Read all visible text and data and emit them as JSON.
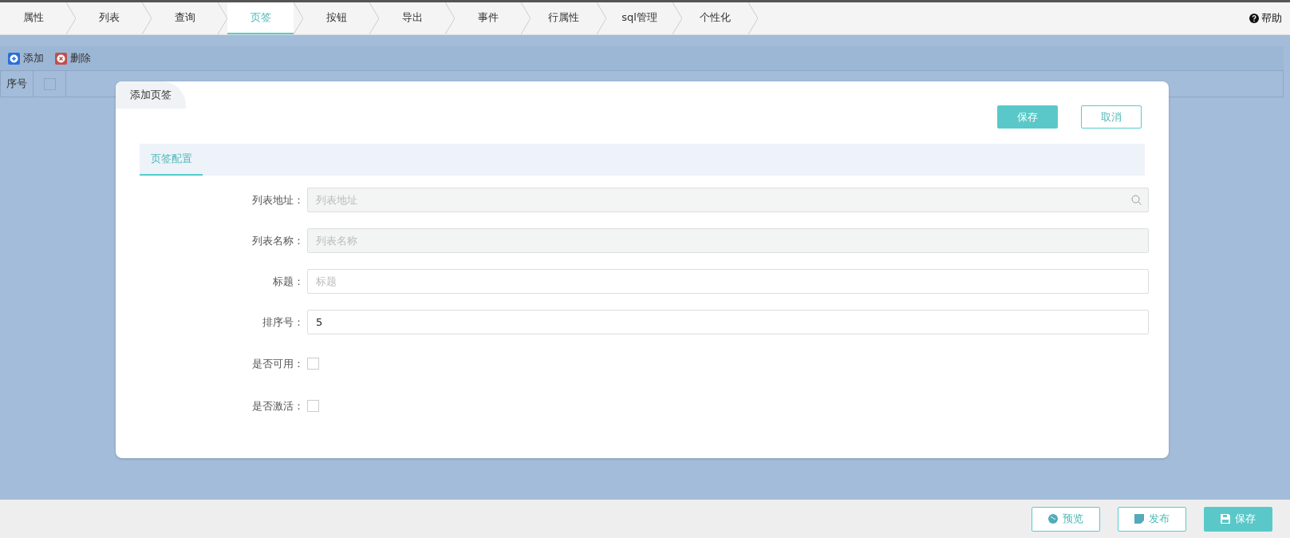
{
  "tabs": [
    {
      "label": "属性",
      "selected": false
    },
    {
      "label": "列表",
      "selected": false
    },
    {
      "label": "查询",
      "selected": false
    },
    {
      "label": "页签",
      "selected": true
    },
    {
      "label": "按钮",
      "selected": false
    },
    {
      "label": "导出",
      "selected": false
    },
    {
      "label": "事件",
      "selected": false
    },
    {
      "label": "行属性",
      "selected": false
    },
    {
      "label": "sql管理",
      "selected": false
    },
    {
      "label": "个性化",
      "selected": false
    }
  ],
  "help": "帮助",
  "toolbar": [
    {
      "kind": "add",
      "label": "添加"
    },
    {
      "kind": "delete",
      "label": "删除"
    }
  ],
  "table": {
    "columns": [
      {
        "kind": "text",
        "label": "序号"
      },
      {
        "kind": "checkbox",
        "checked": false
      }
    ]
  },
  "dialog": {
    "title": "添加页签",
    "buttons": [
      {
        "kind": "primary",
        "label": "保存"
      },
      {
        "kind": "outline",
        "label": "取消"
      }
    ],
    "tabs": [
      {
        "label": "页签配置",
        "selected": true
      }
    ],
    "fields": [
      {
        "kind": "lookup",
        "label": "列表地址：",
        "placeholder": "列表地址",
        "disabled": true
      },
      {
        "kind": "input",
        "label": "列表名称：",
        "placeholder": "列表名称",
        "disabled": true
      },
      {
        "kind": "input",
        "label": "标题：",
        "placeholder": "标题",
        "disabled": false
      },
      {
        "kind": "input",
        "label": "排序号：",
        "value": "5",
        "disabled": false
      },
      {
        "kind": "checkbox",
        "label": "是否可用：",
        "checked": false
      },
      {
        "kind": "checkbox",
        "label": "是否激活：",
        "checked": false
      }
    ]
  },
  "footer": [
    {
      "kind": "preview",
      "label": "预览",
      "primary": false
    },
    {
      "kind": "publish",
      "label": "发布",
      "primary": false
    },
    {
      "kind": "save",
      "label": "保存",
      "primary": true
    }
  ]
}
